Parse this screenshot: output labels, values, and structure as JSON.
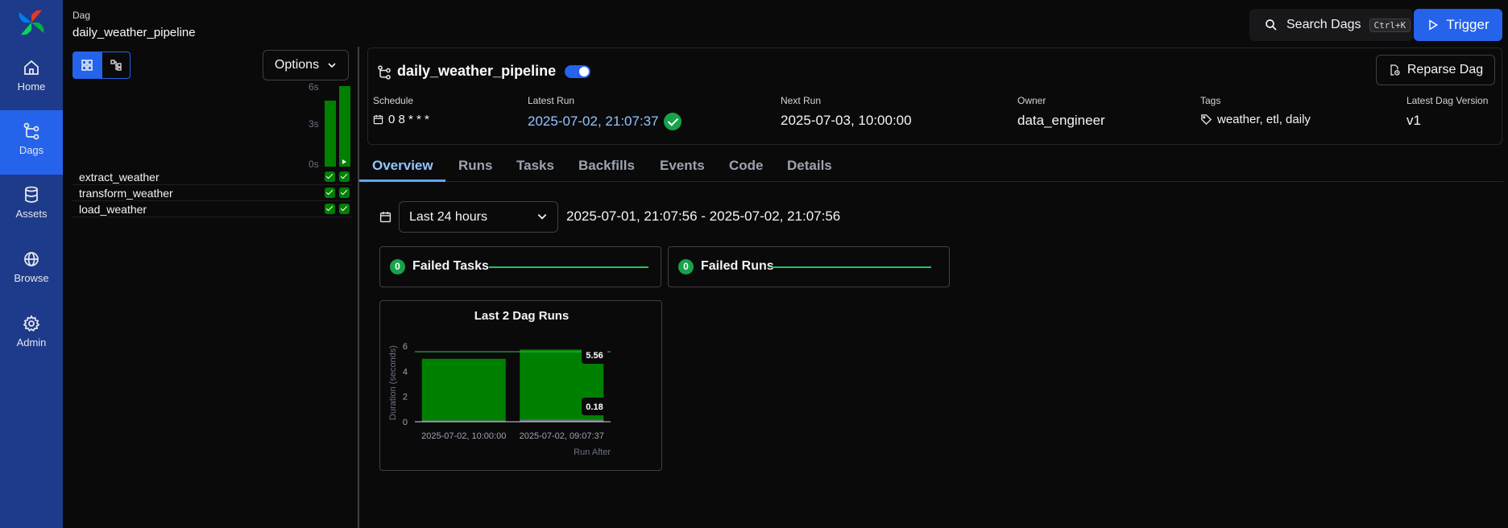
{
  "nav": {
    "items": [
      {
        "label": "Home"
      },
      {
        "label": "Dags"
      },
      {
        "label": "Assets"
      },
      {
        "label": "Browse"
      },
      {
        "label": "Admin"
      }
    ]
  },
  "header": {
    "section": "Dag",
    "dag_id": "daily_weather_pipeline",
    "search_label": "Search Dags",
    "search_shortcut": "Ctrl+K",
    "trigger_label": "Trigger"
  },
  "grid": {
    "options_label": "Options",
    "y_ticks": [
      "6s",
      "3s",
      "0s"
    ],
    "run_durations_s": [
      4.8,
      5.74
    ],
    "tasks": [
      {
        "name": "extract_weather"
      },
      {
        "name": "transform_weather"
      },
      {
        "name": "load_weather"
      }
    ]
  },
  "dag": {
    "name": "daily_weather_pipeline",
    "paused": false,
    "reparse_label": "Reparse Dag",
    "meta": {
      "schedule": {
        "label": "Schedule",
        "value": "0 8 * * *"
      },
      "latest_run": {
        "label": "Latest Run",
        "value": "2025-07-02, 21:07:37"
      },
      "next_run": {
        "label": "Next Run",
        "value": "2025-07-03, 10:00:00"
      },
      "owner": {
        "label": "Owner",
        "value": "data_engineer"
      },
      "tags": {
        "label": "Tags",
        "value": "weather, etl, daily"
      },
      "version": {
        "label": "Latest Dag Version",
        "value": "v1"
      }
    }
  },
  "tabs": [
    {
      "label": "Overview",
      "active": true
    },
    {
      "label": "Runs"
    },
    {
      "label": "Tasks"
    },
    {
      "label": "Backfills"
    },
    {
      "label": "Events"
    },
    {
      "label": "Code"
    },
    {
      "label": "Details"
    }
  ],
  "filter": {
    "range_label": "Last 24 hours",
    "range_text": "2025-07-01, 21:07:56 - 2025-07-02, 21:07:56"
  },
  "stats": {
    "failed_tasks": {
      "count": "0",
      "label": "Failed Tasks"
    },
    "failed_runs": {
      "count": "0",
      "label": "Failed Runs"
    }
  },
  "colors": {
    "nav_bg": "#1e3a8a",
    "accent": "#2563eb",
    "success": "#008000"
  },
  "chart_data": {
    "type": "bar",
    "title": "Last 2 Dag Runs",
    "ylabel": "Duration (seconds)",
    "xlabel": "Run After",
    "categories": [
      "2025-07-02, 10:00:00",
      "2025-07-02, 09:07:37"
    ],
    "series": [
      {
        "values": [
          0.1,
          0.18
        ]
      },
      {
        "values": [
          4.9,
          5.56
        ]
      }
    ],
    "y_ticks": [
      0,
      2,
      4,
      6
    ],
    "ylim": [
      0,
      6.2
    ],
    "reference_line": 5.56,
    "data_labels": [
      "5.56",
      "0.18"
    ]
  }
}
